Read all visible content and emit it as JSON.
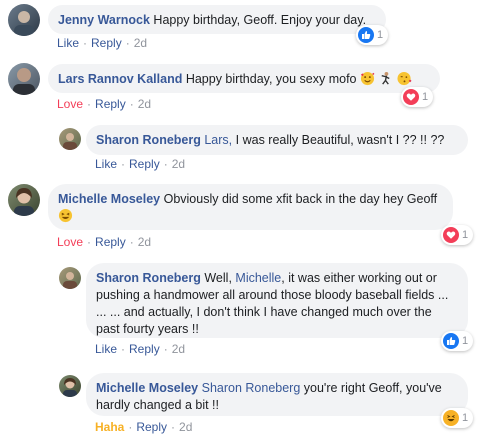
{
  "comments": [
    {
      "name": "Jenny Warnock",
      "text": "Happy birthday, Geoff. Enjoy your day.",
      "action": "Like",
      "reply": "Reply",
      "time": "2d",
      "reaction": {
        "type": "like-icon",
        "count": "1",
        "color": "#1877f2"
      }
    },
    {
      "name": "Lars Rannov Kalland",
      "text": "Happy birthday, you sexy mofo",
      "action": "Love",
      "reply": "Reply",
      "time": "2d",
      "reaction": {
        "type": "heart-icon",
        "count": "1",
        "color": "#f33e58"
      }
    },
    {
      "name": "Sharon Roneberg",
      "mention": "Lars,",
      "text": "I was really Beautiful, wasn't I ?? !! ??",
      "action": "Like",
      "reply": "Reply",
      "time": "2d"
    },
    {
      "name": "Michelle Moseley",
      "text": "Obviously did some xfit back in the day hey Geoff",
      "action": "Love",
      "reply": "Reply",
      "time": "2d",
      "reaction": {
        "type": "heart-icon",
        "count": "1",
        "color": "#f33e58"
      }
    },
    {
      "name": "Sharon Roneberg",
      "text_before": "Well,",
      "mention": "Michelle",
      "text_after": ", it was either working out or",
      "line2": "pushing a handmower all around those bloody baseball fields ...",
      "line3": "... ... and actually, I don't think I have changed much over the",
      "line4": "past fourty years !!",
      "action": "Like",
      "reply": "Reply",
      "time": "2d",
      "reaction": {
        "type": "like-icon",
        "count": "1",
        "color": "#1877f2"
      }
    },
    {
      "name": "Michelle Moseley",
      "mention": "Sharon Roneberg",
      "text": "you're right Geoff, you've",
      "line2": "hardly changed a bit !!",
      "action": "Haha",
      "reply": "Reply",
      "time": "2d",
      "reaction": {
        "type": "haha-icon",
        "count": "1",
        "color": "#f7b125"
      }
    }
  ]
}
